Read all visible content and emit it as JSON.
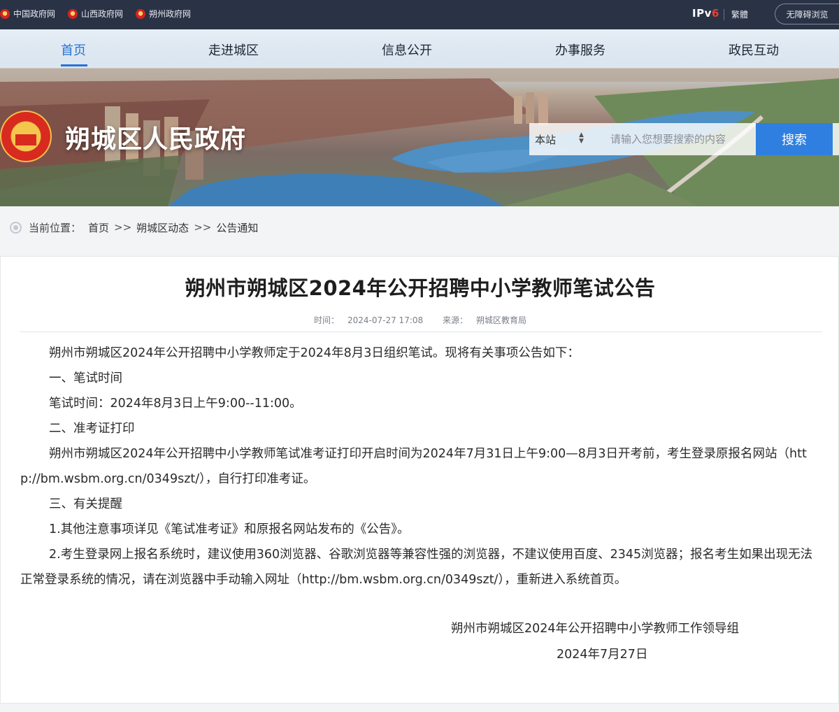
{
  "topbar": {
    "links": [
      {
        "label": "中国政府网",
        "icon": "emblem-icon"
      },
      {
        "label": "山西政府网",
        "icon": "emblem-icon"
      },
      {
        "label": "朔州政府网",
        "icon": "emblem-icon"
      }
    ],
    "ipv6_prefix": "IPv",
    "ipv6_suffix": "6",
    "traditional": "繁體",
    "accessibility": "无障碍浏览"
  },
  "nav": {
    "items": [
      "首页",
      "走进城区",
      "信息公开",
      "办事服务",
      "政民互动"
    ],
    "active_index": 0
  },
  "site": {
    "title": "朔城区人民政府",
    "logo_icon": "national-emblem-icon"
  },
  "search": {
    "scope": "本站",
    "placeholder": "请输入您想要搜索的内容",
    "button": "搜索"
  },
  "breadcrumb": {
    "label": "当前位置：",
    "items": [
      "首页",
      "朔城区动态",
      "公告通知"
    ],
    "separator": ">>"
  },
  "article": {
    "title": "朔州市朔城区2024年公开招聘中小学教师笔试公告",
    "time_label": "时间：",
    "time": "2024-07-27 17:08",
    "source_label": "来源：",
    "source": "朔城区教育局",
    "paragraphs": [
      "朔州市朔城区2024年公开招聘中小学教师定于2024年8月3日组织笔试。现将有关事项公告如下：",
      "一、笔试时间",
      "笔试时间：2024年8月3日上午9:00--11:00。",
      "二、准考证打印",
      "朔州市朔城区2024年公开招聘中小学教师笔试准考证打印开启时间为2024年7月31日上午9:00—8月3日开考前，考生登录原报名网站（http://bm.wsbm.org.cn/0349szt/），自行打印准考证。",
      "三、有关提醒",
      "1.其他注意事项详见《笔试准考证》和原报名网站发布的《公告》。",
      "2.考生登录网上报名系统时，建议使用360浏览器、谷歌浏览器等兼容性强的浏览器，不建议使用百度、2345浏览器；报名考生如果出现无法正常登录系统的情况，请在浏览器中手动输入网址（http://bm.wsbm.org.cn/0349szt/），重新进入系统首页。"
    ],
    "signature": "朔州市朔城区2024年公开招聘中小学教师工作领导组",
    "date": "2024年7月27日"
  },
  "colors": {
    "topbar": "#2a3346",
    "accent": "#2673d9",
    "search_button": "#2f7fe0",
    "ipv6_red": "#e8412e"
  }
}
